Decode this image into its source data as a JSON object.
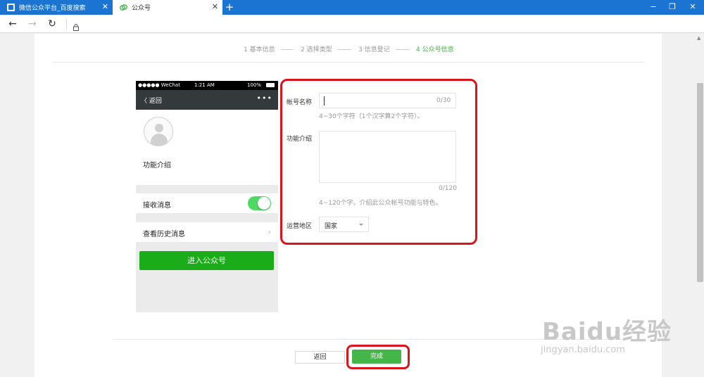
{
  "browser": {
    "tabs": [
      {
        "title": "微信公众平台_百度搜索",
        "active": false
      },
      {
        "title": "公众号",
        "active": true
      }
    ],
    "new_tab_label": "+",
    "window_controls": {
      "minimize": "−",
      "restore": "❐",
      "close": "✕"
    },
    "nav": {
      "back": "←",
      "forward": "→",
      "refresh": "↻"
    }
  },
  "steps": [
    {
      "label": "1 基本信息",
      "active": false
    },
    {
      "label": "2 选择类型",
      "active": false
    },
    {
      "label": "3 信息登记",
      "active": false
    },
    {
      "label": "4 公众号信息",
      "active": true
    }
  ],
  "phone": {
    "status_left": "●●●●● WeChat",
    "status_time": "1:21 AM",
    "status_battery": "100%",
    "back_label": "〈 返回",
    "more_label": "•••",
    "intro_label": "功能介绍",
    "receive_label": "接收消息",
    "receive_enabled": true,
    "history_label": "查看历史消息",
    "enter_button": "进入公众号"
  },
  "form": {
    "account_name_label": "帐号名称",
    "account_name_value": "",
    "account_name_counter": "0/30",
    "account_name_hint": "4~30个字符（1个汉字算2个字符）。",
    "intro_label": "功能介绍",
    "intro_value": "",
    "intro_counter": "0/120",
    "intro_hint": "4~120个字，介绍此公众帐号功能与特色。",
    "region_label": "运营地区",
    "region_value": "国家"
  },
  "footer": {
    "back_button": "返回",
    "done_button": "完成"
  },
  "watermark": {
    "brand": "Baidu经验",
    "url": "jingyan.baidu.com"
  },
  "colors": {
    "accent_green": "#44b549",
    "highlight_red": "#d9141b",
    "browser_blue": "#1b74d2"
  }
}
